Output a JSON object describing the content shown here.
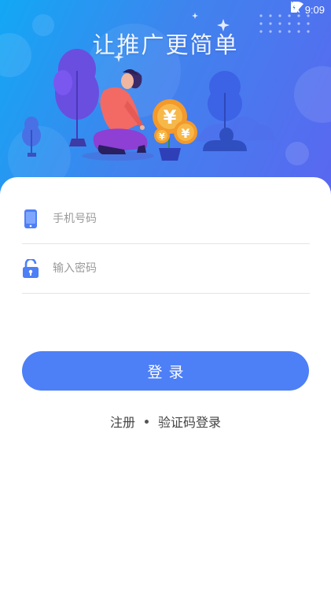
{
  "status_bar": {
    "time": "9:09"
  },
  "hero": {
    "slogan": "让推广更简单",
    "coin_symbol": "¥"
  },
  "form": {
    "phone_placeholder": "手机号码",
    "password_placeholder": "输入密码"
  },
  "actions": {
    "login_label": "登录",
    "register_label": "注册",
    "sms_login_label": "验证码登录"
  },
  "colors": {
    "primary": "#4d7ff6",
    "hero_gradient_start": "#12a8f5",
    "hero_gradient_end": "#5a67f0",
    "lock_orange": "#f5a623",
    "coin_orange": "#f39a2b"
  }
}
